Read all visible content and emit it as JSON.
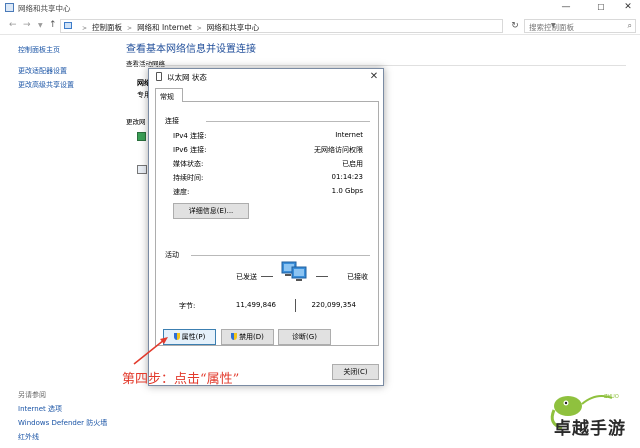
{
  "window": {
    "title": "网络和共享中心",
    "controls": {
      "minimize": "—",
      "maximize": "☐",
      "close": "✕"
    }
  },
  "address": {
    "crumbs": [
      "控制面板",
      "网络和 Internet",
      "网络和共享中心"
    ],
    "search_placeholder": "搜索控制面板"
  },
  "left_pane": {
    "links": [
      "控制面板主页",
      "更改适配器设置",
      "更改高级共享设置"
    ],
    "see_also_title": "另请参阅",
    "see_also": [
      "Internet 选项",
      "Windows Defender 防火墙",
      "红外线"
    ]
  },
  "main": {
    "title": "查看基本网络信息并设置连接",
    "active_networks_title": "查看活动网络",
    "fragment_network_name": "网络",
    "fragment_network_type": "专用",
    "fragment_change_settings": "更改网"
  },
  "dialog": {
    "title": "以太网 状态",
    "close": "✕",
    "tab": "常规",
    "connection_group": "连接",
    "rows": [
      {
        "label": "IPv4 连接:",
        "value": "Internet"
      },
      {
        "label": "IPv6 连接:",
        "value": "无网络访问权限"
      },
      {
        "label": "媒体状态:",
        "value": "已启用"
      },
      {
        "label": "持续时间:",
        "value": "01:14:23"
      },
      {
        "label": "速度:",
        "value": "1.0 Gbps"
      }
    ],
    "details_button": "详细信息(E)...",
    "activity_group": "活动",
    "sent_label": "已发送",
    "received_label": "已接收",
    "bytes_label": "字节:",
    "bytes_sent": "11,499,846",
    "bytes_received": "220,099,354",
    "properties_button": "属性(P)",
    "disable_button": "禁用(D)",
    "diagnose_button": "诊断(G)",
    "close_button": "关闭(C)"
  },
  "annotation": {
    "text": "第四步：点击“属性”",
    "color": "#e23a2c"
  },
  "watermark": {
    "text": "卓越手游"
  }
}
